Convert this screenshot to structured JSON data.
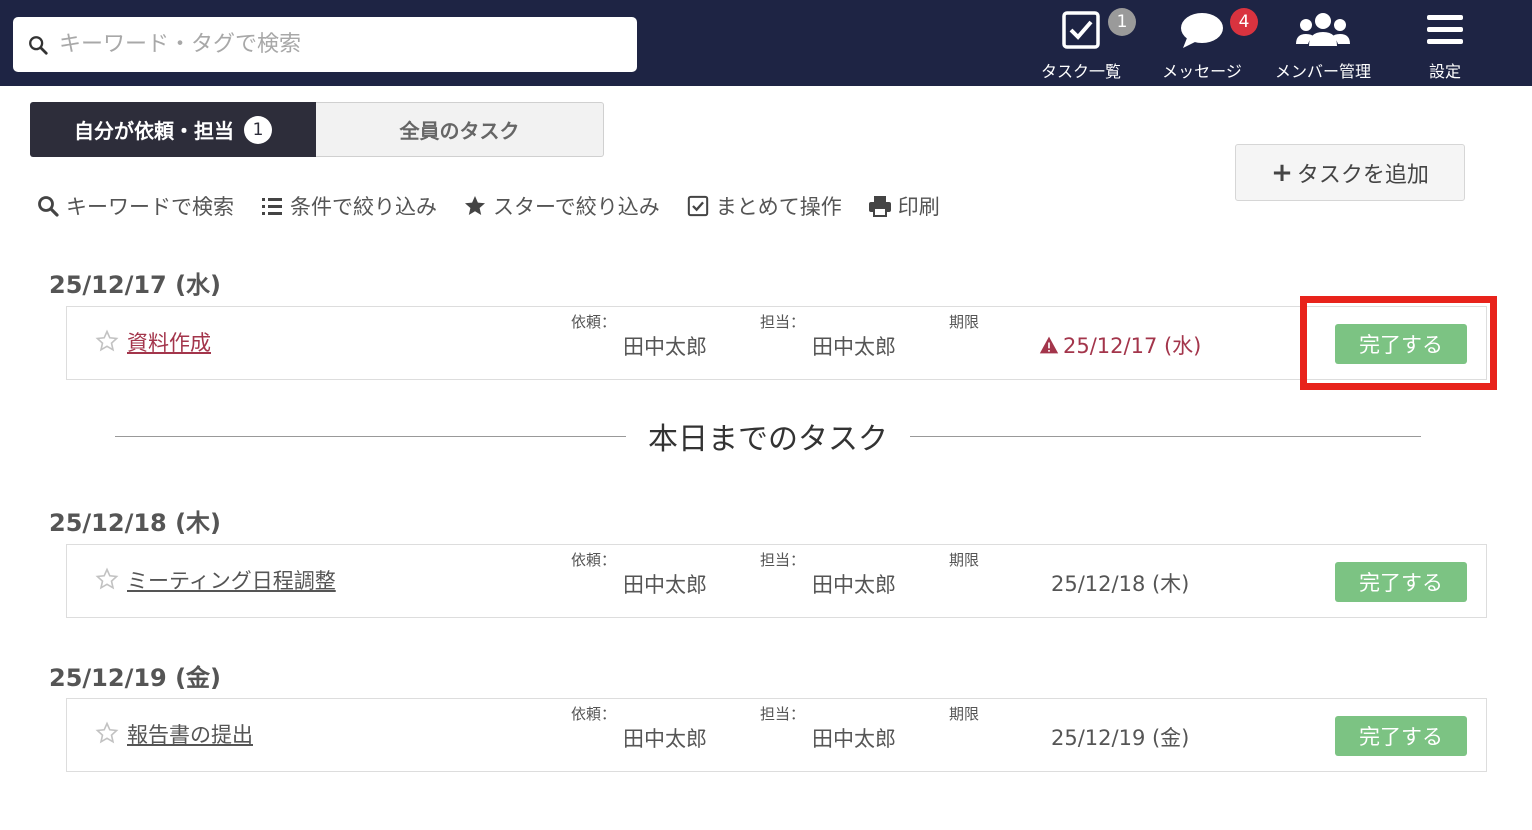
{
  "header": {
    "search_placeholder": "キーワード・タグで検索",
    "nav": [
      {
        "label": "タスク一覧",
        "icon": "checkbox-icon",
        "badge": "1"
      },
      {
        "label": "メッセージ",
        "icon": "chat-bubble-icon",
        "badge": "4"
      },
      {
        "label": "メンバー管理",
        "icon": "users-icon",
        "badge": ""
      },
      {
        "label": "設定",
        "icon": "hamburger-menu-icon",
        "badge": ""
      }
    ]
  },
  "tabs": {
    "mine_label": "自分が依頼・担当",
    "mine_badge": "1",
    "all_label": "全員のタスク"
  },
  "add_task_label": "タスクを追加",
  "toolbar": {
    "keyword_search": "キーワードで検索",
    "filter_conditions": "条件で絞り込み",
    "filter_star": "スターで絞り込み",
    "bulk_operation": "まとめて操作",
    "print": "印刷"
  },
  "divider_label": "本日までのタスク",
  "groups": [
    {
      "date": "25/12/17 (水)",
      "task": {
        "title": "資料作成",
        "requester_label": "依頼：",
        "requester": "田中太郎",
        "assignee_label": "担当：",
        "assignee": "田中太郎",
        "due_label": "期限",
        "due": "25/12/17 (水)",
        "overdue": true,
        "complete_label": "完了する"
      }
    },
    {
      "date": "25/12/18 (木)",
      "task": {
        "title": "ミーティング日程調整",
        "requester_label": "依頼：",
        "requester": "田中太郎",
        "assignee_label": "担当：",
        "assignee": "田中太郎",
        "due_label": "期限",
        "due": "25/12/18 (木)",
        "overdue": false,
        "complete_label": "完了する"
      }
    },
    {
      "date": "25/12/19 (金)",
      "task": {
        "title": "報告書の提出",
        "requester_label": "依頼：",
        "requester": "田中太郎",
        "assignee_label": "担当：",
        "assignee": "田中太郎",
        "due_label": "期限",
        "due": "25/12/19 (金)",
        "overdue": false,
        "complete_label": "完了する"
      }
    }
  ],
  "colors": {
    "header_bg": "#1e2444",
    "overdue_text": "#a3354b",
    "complete_button": "#7cc383",
    "highlight_box": "#e8231b",
    "badge_gray": "#9a9a9a",
    "badge_red": "#d9333f"
  }
}
